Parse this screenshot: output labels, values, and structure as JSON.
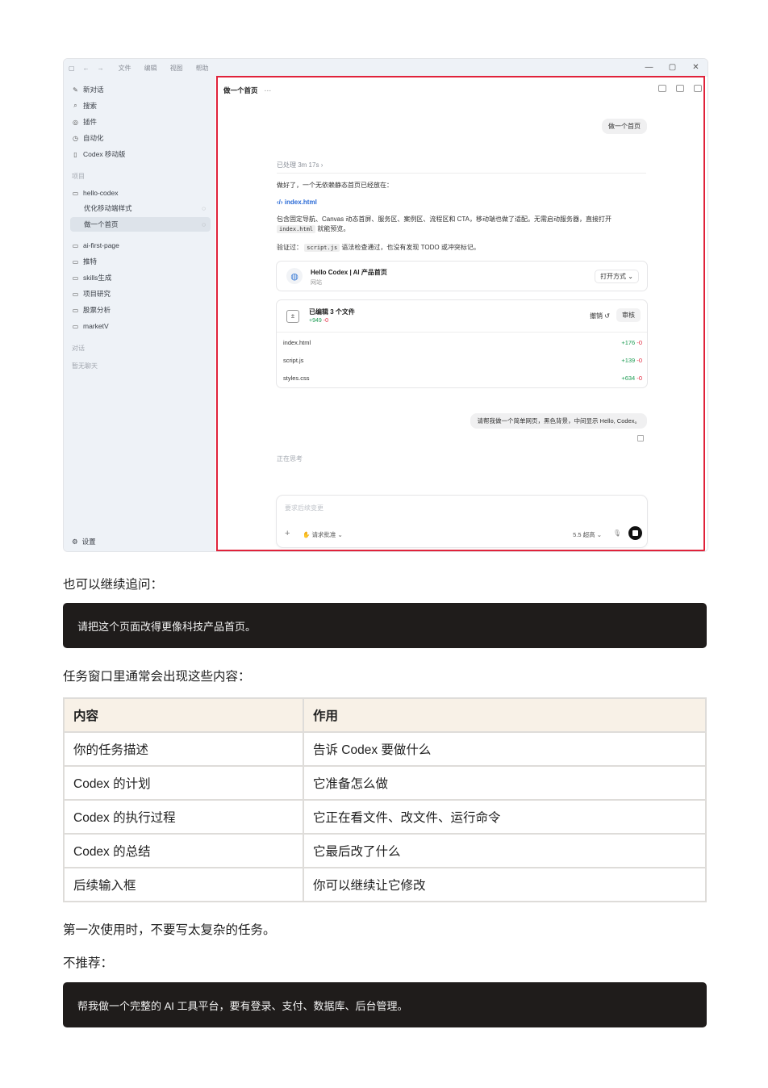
{
  "app": {
    "menu": [
      "文件",
      "编辑",
      "视图",
      "帮助"
    ],
    "window_controls": [
      "—",
      "▢",
      "✕"
    ],
    "sidebar": {
      "top_items": [
        {
          "icon": "edit-icon",
          "label": "新对话"
        },
        {
          "icon": "search-icon",
          "label": "搜索"
        },
        {
          "icon": "plugin-icon",
          "label": "插件"
        },
        {
          "icon": "clock-icon",
          "label": "自动化"
        },
        {
          "icon": "phone-icon",
          "label": "Codex 移动版"
        }
      ],
      "projects_label": "项目",
      "project_main": "hello-codex",
      "project_subitems": [
        "优化移动端样式",
        "做一个首页"
      ],
      "projects": [
        "ai-first-page",
        "推特",
        "skills生成",
        "项目研究",
        "股票分析",
        "marketV"
      ],
      "chats_label": "对话",
      "no_chats": "暂无聊天",
      "settings": "设置"
    },
    "main": {
      "title": "做一个首页",
      "user_message": "做一个首页",
      "processed": "已处理 3m 17s",
      "response_intro": "做好了，一个无依赖静态首页已经放在：",
      "file_link": "index.html",
      "response_desc1": "包含固定导航、Canvas 动态首屏、服务区、案例区、流程区和 CTA，移动端也做了适配。无需启动服务器，直接打开",
      "response_code": "index.html",
      "response_desc2": "就能预览。",
      "verify_prefix": "验证过：",
      "verify_code": "script.js",
      "verify_suffix": "语法检查通过，也没有发现 TODO 或冲突标记。",
      "preview_card": {
        "title": "Hello Codex | AI 产品首页",
        "subtitle": "网站",
        "open_with": "打开方式"
      },
      "edited_card": {
        "title": "已编辑 3 个文件",
        "added": "+949",
        "removed": "-0",
        "undo": "撤销",
        "review": "审核",
        "files": [
          {
            "name": "index.html",
            "added": "+176",
            "removed": "-0"
          },
          {
            "name": "script.js",
            "added": "+139",
            "removed": "-0"
          },
          {
            "name": "styles.css",
            "added": "+634",
            "removed": "-0"
          }
        ]
      },
      "user_message2": "请帮我做一个简单网页，黑色背景，中间显示 Hello, Codex。",
      "thinking": "正在思考",
      "composer": {
        "placeholder": "要求后续变更",
        "approval": "请求批准",
        "model": "5.5 超高"
      }
    }
  },
  "doc": {
    "para1": "也可以继续追问：",
    "code1": "请把这个页面改得更像科技产品首页。",
    "para2": "任务窗口里通常会出现这些内容：",
    "table": {
      "headers": [
        "内容",
        "作用"
      ],
      "rows": [
        [
          "你的任务描述",
          "告诉 Codex 要做什么"
        ],
        [
          "Codex 的计划",
          "它准备怎么做"
        ],
        [
          "Codex 的执行过程",
          "它正在看文件、改文件、运行命令"
        ],
        [
          "Codex 的总结",
          "它最后改了什么"
        ],
        [
          "后续输入框",
          "你可以继续让它修改"
        ]
      ]
    },
    "para3": "第一次使用时，不要写太复杂的任务。",
    "para4": "不推荐：",
    "code2": "帮我做一个完整的 AI 工具平台，要有登录、支付、数据库、后台管理。"
  }
}
